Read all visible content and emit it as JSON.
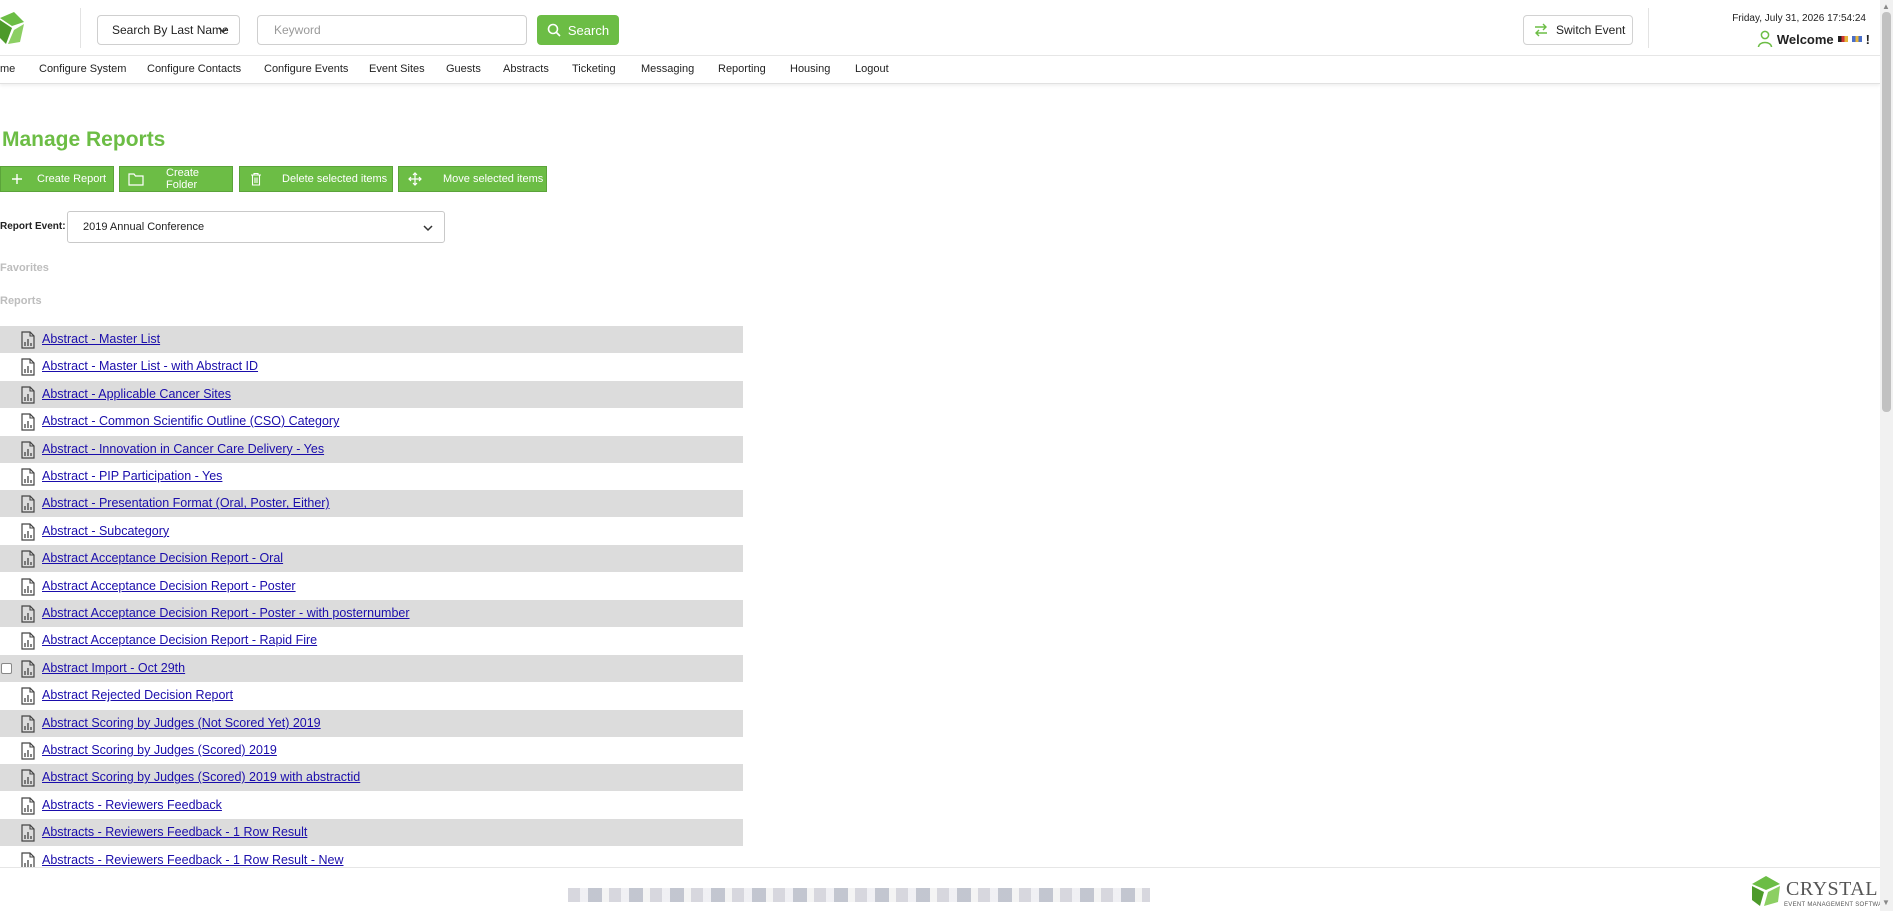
{
  "header": {
    "search_by_label": "Search By Last Name",
    "keyword_placeholder": "Keyword",
    "search_button": "Search",
    "switch_event_button": "Switch Event",
    "datetime": "Friday, July 31, 2026 17:54:24",
    "welcome": "Welcome",
    "welcome_suffix": "!"
  },
  "nav": {
    "items": [
      "me",
      "Configure System",
      "Configure Contacts",
      "Configure Events",
      "Event Sites",
      "Guests",
      "Abstracts",
      "Ticketing",
      "Messaging",
      "Reporting",
      "Housing",
      "Logout"
    ]
  },
  "main": {
    "title": "Manage Reports",
    "actions": [
      "Create Report",
      "Create Folder",
      "Delete selected items",
      "Move selected items"
    ],
    "report_event_label": "Report Event:",
    "report_event_value": "2019 Annual Conference",
    "favorites_label": "Favorites",
    "reports_label": "Reports"
  },
  "reports": [
    "Abstract - Master List",
    "Abstract - Master List - with Abstract ID",
    "Abstract - Applicable Cancer Sites",
    "Abstract - Common Scientific Outline (CSO) Category",
    "Abstract - Innovation in Cancer Care Delivery - Yes",
    "Abstract - PIP Participation - Yes",
    "Abstract - Presentation Format (Oral, Poster, Either)",
    "Abstract - Subcategory",
    "Abstract Acceptance Decision Report - Oral",
    "Abstract Acceptance Decision Report - Poster",
    "Abstract Acceptance Decision Report - Poster - with posternumber",
    "Abstract Acceptance Decision Report - Rapid Fire",
    "Abstract Import - Oct 29th",
    "Abstract Rejected Decision Report",
    "Abstract Scoring by Judges (Not Scored Yet) 2019",
    "Abstract Scoring by Judges (Scored) 2019",
    "Abstract Scoring by Judges (Scored) 2019 with abstractid",
    "Abstracts - Reviewers Feedback",
    "Abstracts - Reviewers Feedback - 1 Row Result",
    "Abstracts - Reviewers Feedback - 1 Row Result - New"
  ],
  "footer": {
    "brand": "CRYSTAL",
    "tagline": "EVENT MANAGEMENT SOFTWARE"
  },
  "colors": {
    "accent": "#6cbd45",
    "link": "#1a0dab",
    "row_shade": "#dcdcdc"
  }
}
